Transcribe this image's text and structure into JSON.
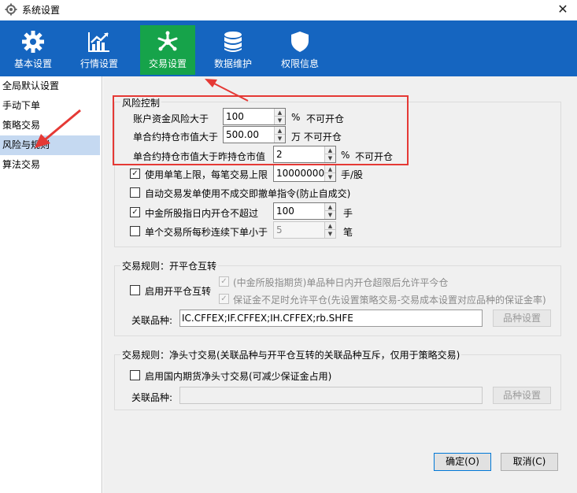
{
  "window": {
    "title": "系统设置",
    "close_label": "✕"
  },
  "toolbar": {
    "tabs": [
      {
        "label": "基本设置",
        "icon": "gear-icon"
      },
      {
        "label": "行情设置",
        "icon": "chart-icon"
      },
      {
        "label": "交易设置",
        "icon": "trade-icon",
        "active": true
      },
      {
        "label": "数据维护",
        "icon": "database-icon"
      },
      {
        "label": "权限信息",
        "icon": "shield-icon"
      }
    ],
    "active_color": "#16a34a",
    "bg_color": "#1565c0"
  },
  "sidebar": {
    "items": [
      {
        "label": "全局默认设置"
      },
      {
        "label": "手动下单"
      },
      {
        "label": "策略交易"
      },
      {
        "label": "风险与规则",
        "selected": true
      },
      {
        "label": "算法交易"
      }
    ]
  },
  "risk": {
    "title": "风险控制",
    "account_risk": {
      "label": "账户资金风险大于",
      "value": "100",
      "unit": "%",
      "suffix": "不可开仓"
    },
    "contract_value": {
      "label": "单合约持仓市值大于",
      "value": "500.00",
      "unit": "万 不可开仓"
    },
    "contract_vs_yesterday": {
      "label": "单合约持仓市值大于昨持仓市值",
      "value": "2",
      "unit": "%",
      "suffix": "不可开仓"
    },
    "single_limit": {
      "label": "使用单笔上限，每笔交易上限",
      "value": "10000000",
      "unit": "手/股",
      "checked": true
    },
    "auto_cancel": {
      "label": "自动交易发单使用不成交即撤单指令(防止自成交)",
      "checked": false
    },
    "cffex_intraday": {
      "label": "中金所股指日内开仓不超过",
      "value": "100",
      "unit": "手",
      "checked": true
    },
    "per_second": {
      "label": "单个交易所每秒连续下单小于",
      "value": "5",
      "unit": "笔",
      "checked": false
    }
  },
  "open_close_rule": {
    "title": "交易规则：开平仓互转",
    "enable_label": "启用开平仓互转",
    "opt1_label": "(中金所股指期货)单品种日内开仓超限后允许平今仓",
    "opt2_label": "保证金不足时允许平仓(先设置策略交易-交易成本设置对应品种的保证金率)",
    "symbols_label": "关联品种:",
    "symbols_value": "IC.CFFEX;IF.CFFEX;IH.CFFEX;rb.SHFE",
    "button_label": "品种设置"
  },
  "net_position_rule": {
    "title": "交易规则：净头寸交易(关联品种与开平仓互转的关联品种互斥，仅用于策略交易)",
    "enable_label": "启用国内期货净头寸交易(可减少保证金占用)",
    "symbols_label": "关联品种:",
    "symbols_value": "",
    "button_label": "品种设置"
  },
  "footer": {
    "ok_label": "确定(O)",
    "cancel_label": "取消(C)"
  }
}
